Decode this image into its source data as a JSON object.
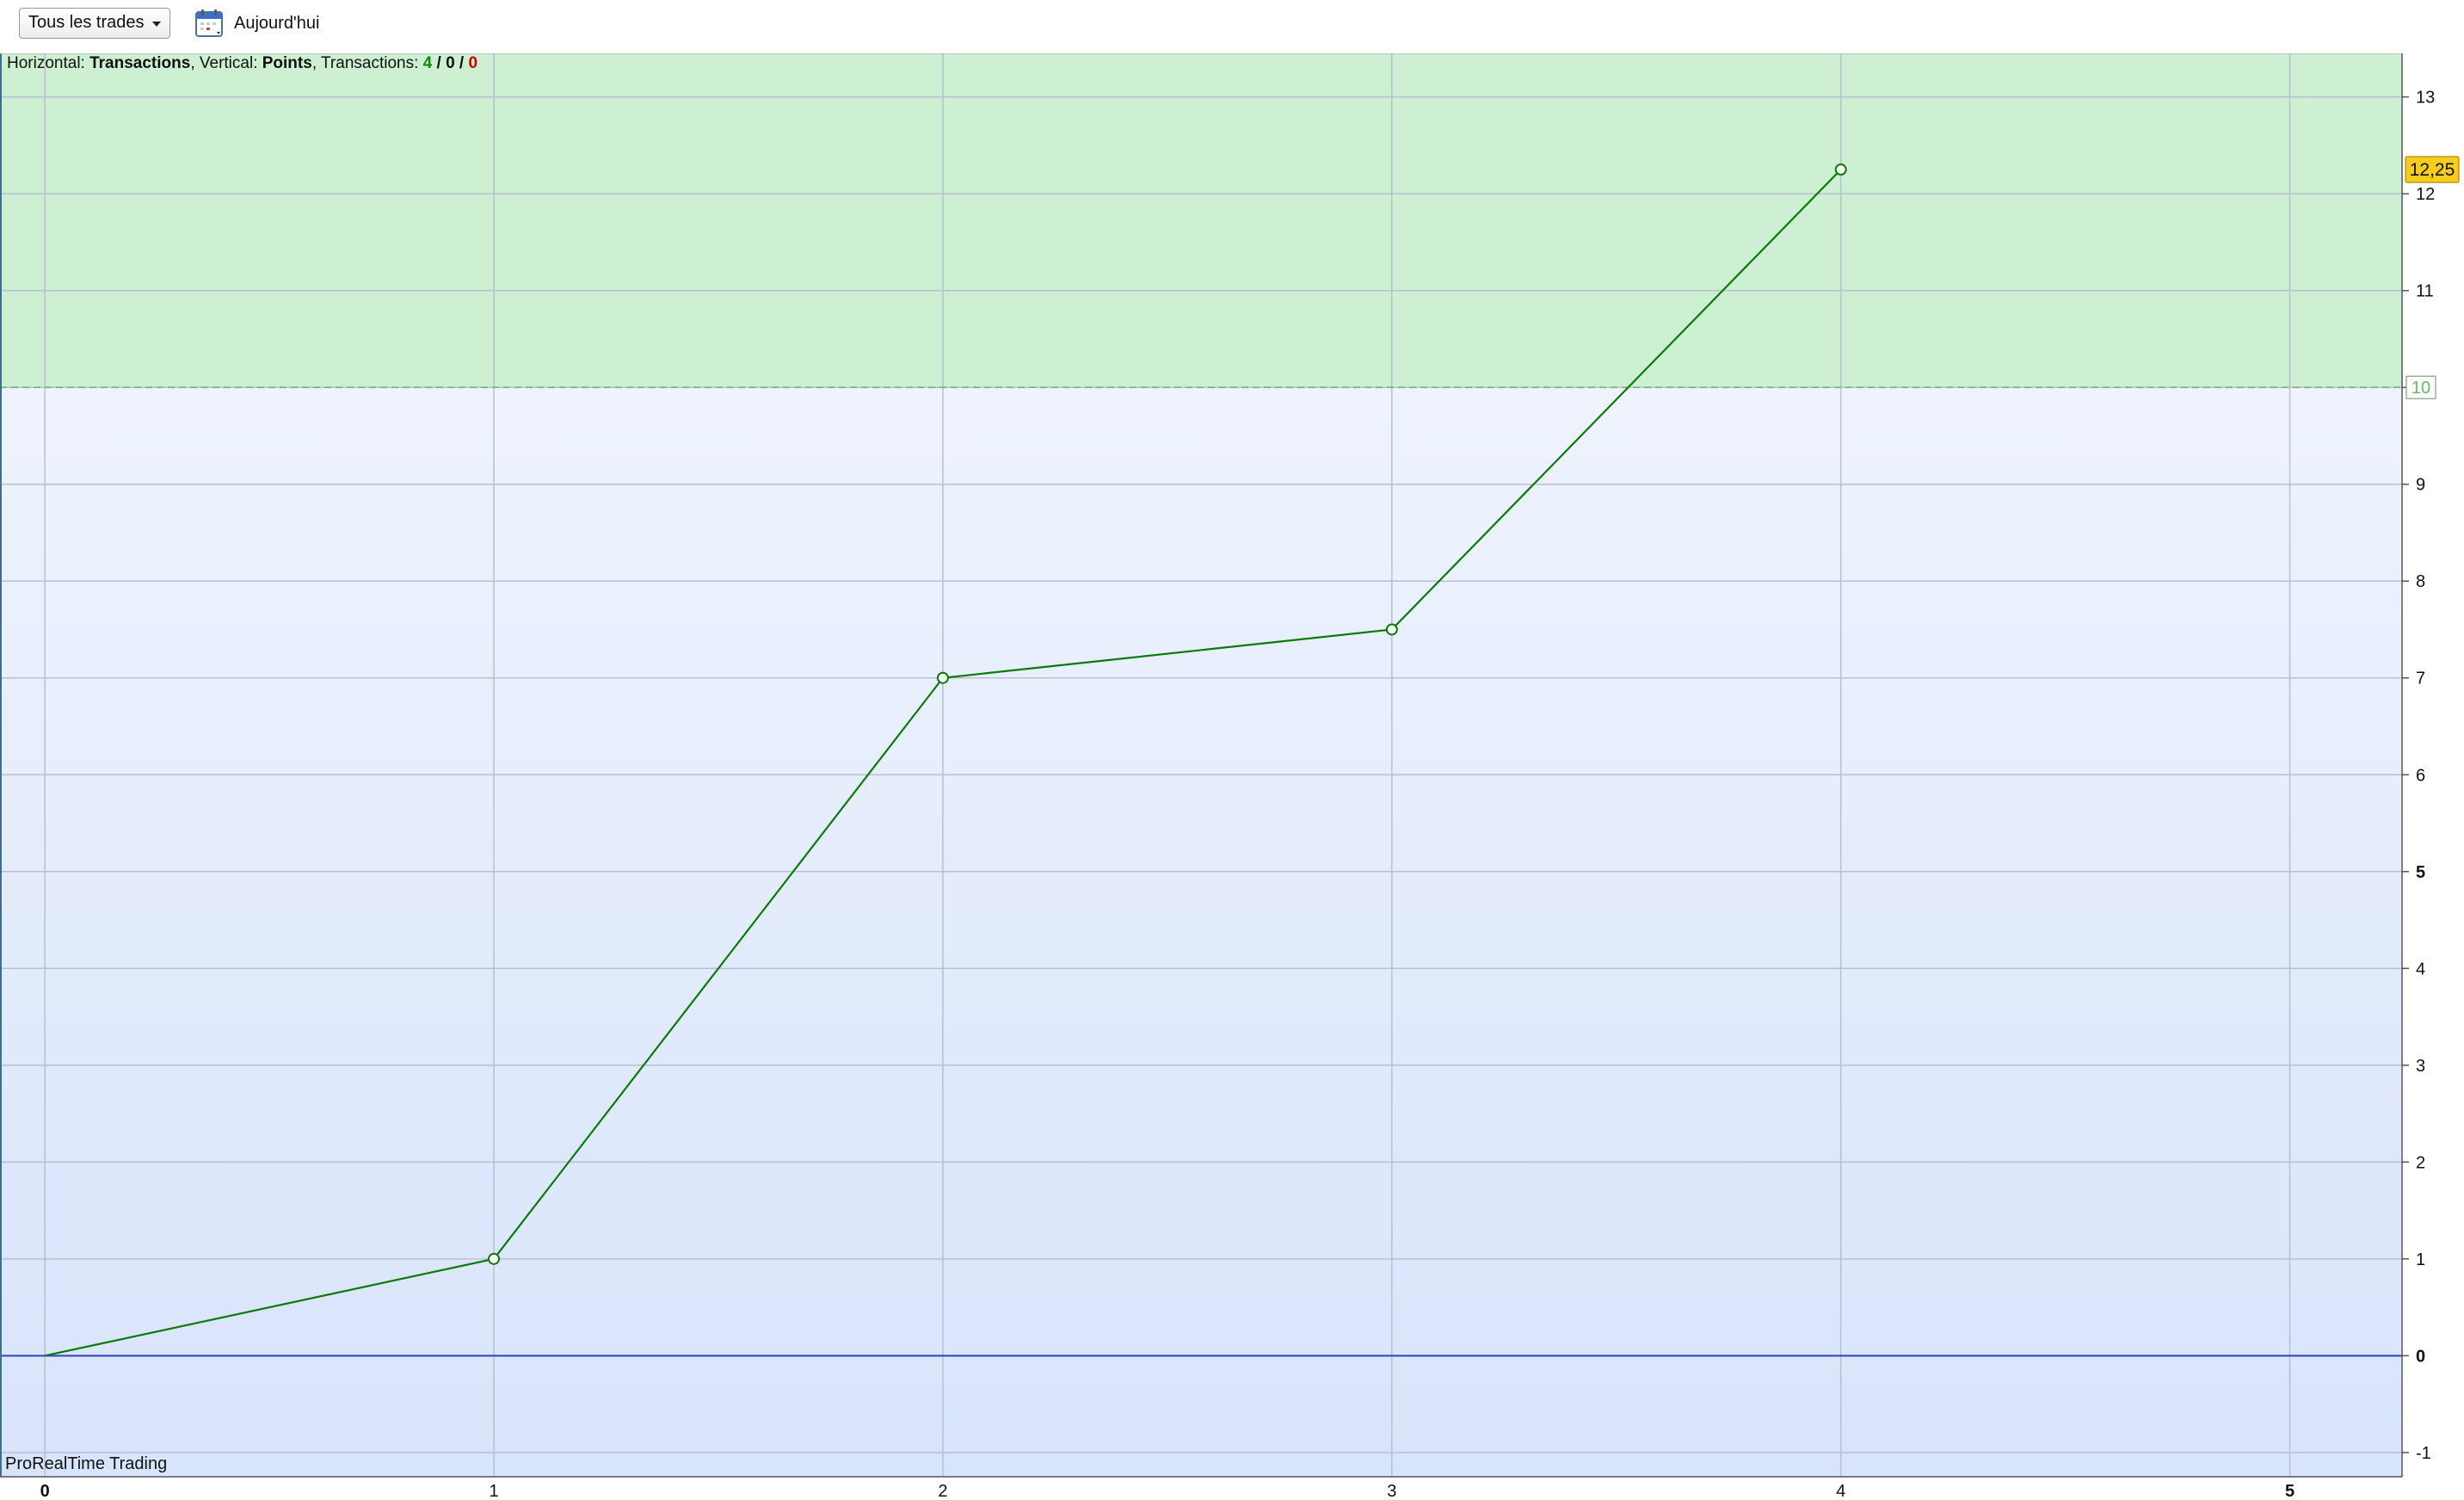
{
  "toolbar": {
    "filter_label": "Tous les trades",
    "date_label": "Aujourd'hui",
    "calendar_icon": "calendar-icon"
  },
  "info": {
    "horizontal_prefix": "Horizontal: ",
    "horizontal_value": "Transactions",
    "vertical_prefix": ", Vertical: ",
    "vertical_value": "Points",
    "transactions_prefix": ", Transactions: ",
    "win_count": "4",
    "neutral_count": "0",
    "loss_count": "0",
    "separator": " / "
  },
  "watermark": "ProRealTime Trading",
  "colors": {
    "line": "#0a7a0a",
    "profit_zone": "#cdf0d3",
    "zero_line": "#2f3fbf",
    "threshold_label": "#5cbf5c",
    "last_value_bg": "#f5cd1e"
  },
  "chart_data": {
    "type": "line",
    "x": [
      0,
      1,
      2,
      3,
      4
    ],
    "y": [
      0,
      1,
      7,
      7.5,
      12.25
    ],
    "xlim": [
      -0.1,
      5.25
    ],
    "ylim": [
      -1.25,
      13.45
    ],
    "x_ticks": [
      "0",
      "1",
      "2",
      "3",
      "4",
      "5"
    ],
    "y_ticks": [
      "-1",
      "0",
      "1",
      "2",
      "3",
      "4",
      "5",
      "6",
      "7",
      "8",
      "9",
      "10",
      "11",
      "12",
      "13"
    ],
    "bold_x_ticks": [
      "0",
      "5"
    ],
    "bold_y_ticks": [
      "0",
      "5"
    ],
    "threshold": 10,
    "threshold_label": "10",
    "last_value": 12.25,
    "last_value_label": "12,25",
    "grid": true,
    "profit_zone_above_threshold": true
  }
}
